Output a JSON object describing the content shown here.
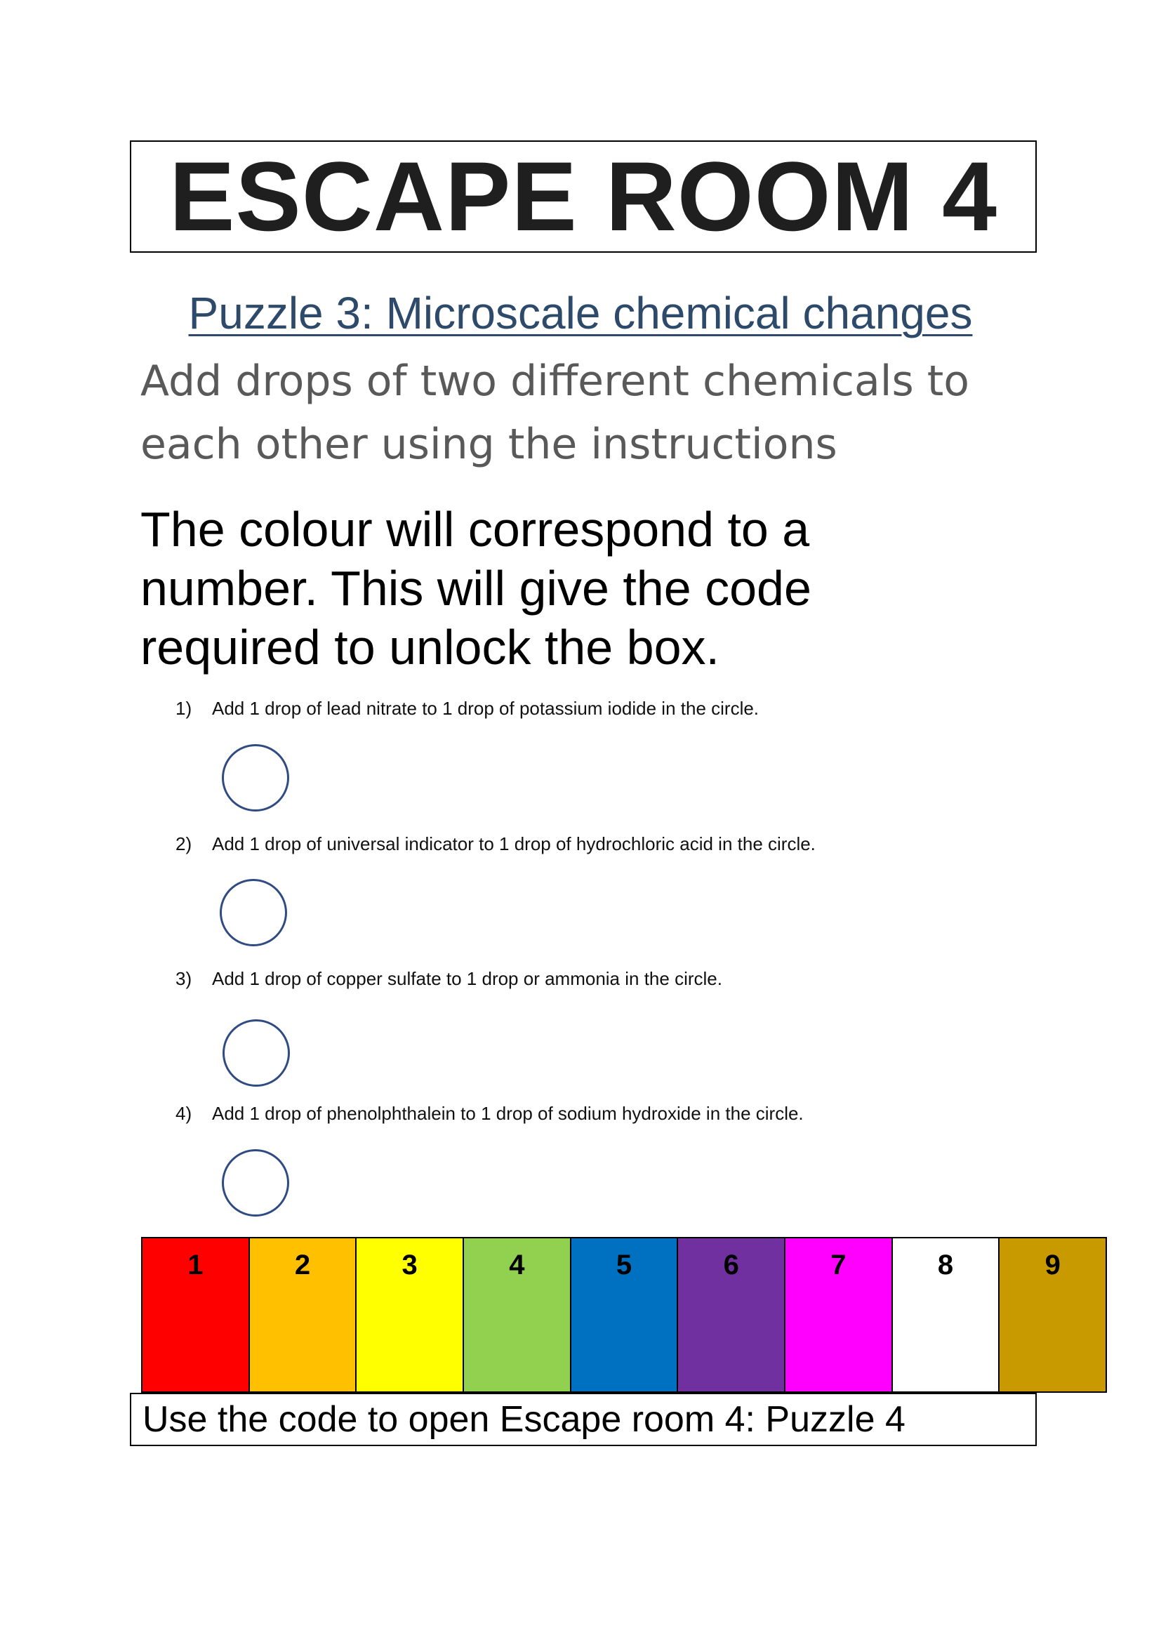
{
  "header": {
    "title": "ESCAPE ROOM 4"
  },
  "puzzle": {
    "heading": "Puzzle 3: Microscale chemical changes",
    "subtitle_line1": "Add drops of two different chemicals to",
    "subtitle_line2": "each other using the instructions",
    "explain_line1": "The colour will correspond to a",
    "explain_line2": "number. This will give the code",
    "explain_line3": "required to unlock the box."
  },
  "steps": [
    {
      "num": "1)",
      "text": "Add 1 drop of lead nitrate to 1 drop of potassium iodide in the circle."
    },
    {
      "num": "2)",
      "text": "Add 1 drop of universal indicator to 1 drop of hydrochloric acid in the circle."
    },
    {
      "num": "3)",
      "text": "Add 1 drop of copper sulfate to 1 drop or ammonia in the circle."
    },
    {
      "num": "4)",
      "text": "Add 1 drop of phenolphthalein to 1 drop of sodium hydroxide in the circle."
    }
  ],
  "colour_key": [
    {
      "number": "1",
      "color": "#ff0000"
    },
    {
      "number": "2",
      "color": "#ffc000"
    },
    {
      "number": "3",
      "color": "#ffff00"
    },
    {
      "number": "4",
      "color": "#92d050"
    },
    {
      "number": "5",
      "color": "#0070c0"
    },
    {
      "number": "6",
      "color": "#7030a0"
    },
    {
      "number": "7",
      "color": "#ff00ff"
    },
    {
      "number": "8",
      "color": "#ffffff"
    },
    {
      "number": "9",
      "color": "#c99a00"
    }
  ],
  "footer": {
    "text": "Use the code to open Escape room 4: Puzzle 4"
  }
}
